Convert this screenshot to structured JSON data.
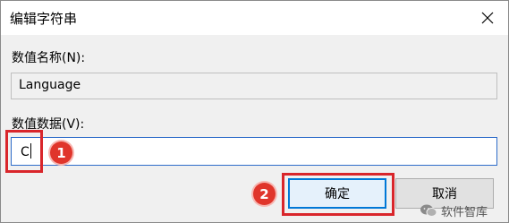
{
  "window": {
    "title": "编辑字符串"
  },
  "value_name": {
    "label": "数值名称(N):",
    "value": "Language"
  },
  "value_data": {
    "label": "数值数据(V):",
    "value": "C"
  },
  "buttons": {
    "ok_label": "确定",
    "cancel_label": "取消"
  },
  "annotations": {
    "step1": "1",
    "step2": "2",
    "highlight_color": "#d9262b"
  },
  "watermark": {
    "text": "软件智库",
    "icon": "wechat-icon"
  },
  "icons": {
    "close": "close-icon"
  }
}
